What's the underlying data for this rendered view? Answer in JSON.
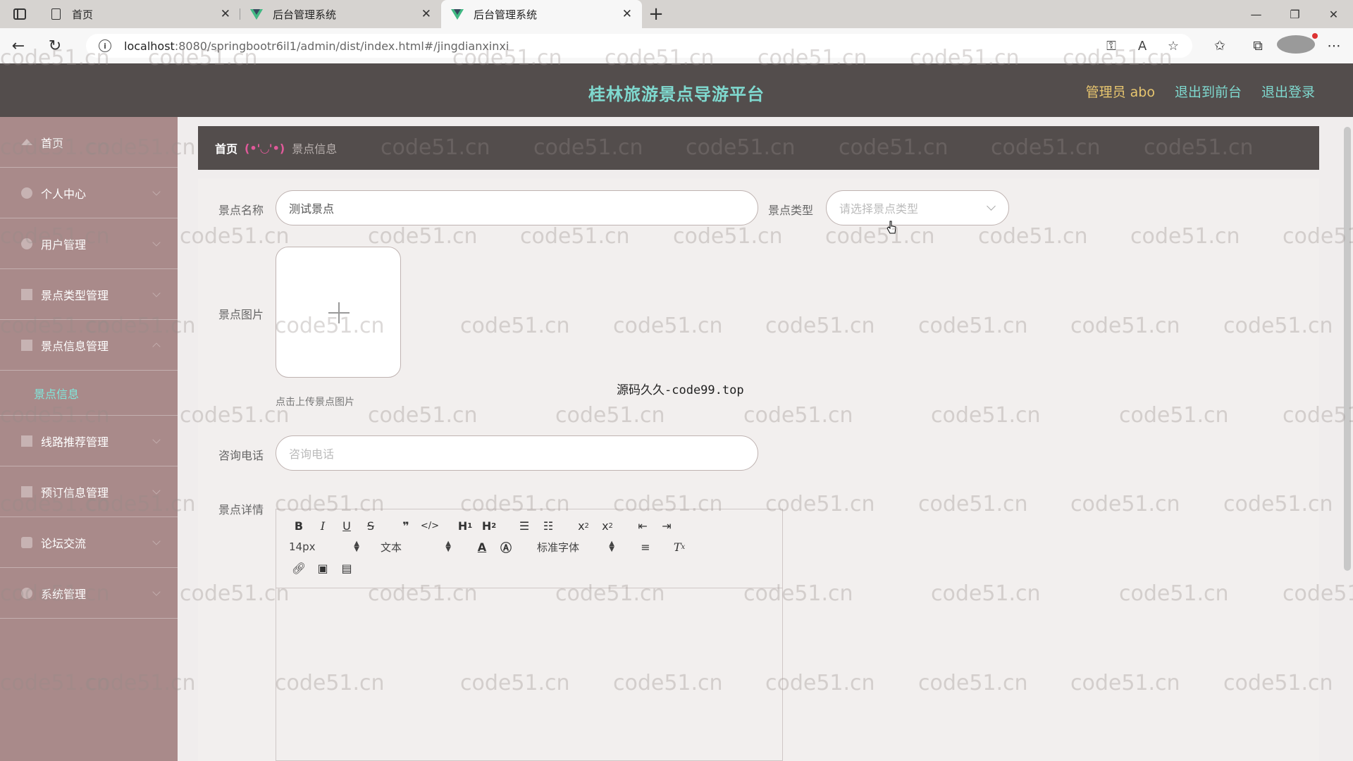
{
  "browser": {
    "tabs": [
      {
        "title": "首页",
        "icon": "doc-icon"
      },
      {
        "title": "后台管理系统",
        "icon": "vue-icon"
      },
      {
        "title": "后台管理系统",
        "icon": "vue-icon",
        "active": true
      }
    ],
    "url_host": "localhost",
    "url_path": ":8080/springbootr6il1/admin/dist/index.html#/jingdianxinxi"
  },
  "header": {
    "title": "桂林旅游景点导游平台",
    "user": "管理员 abo",
    "back_front": "退出到前台",
    "logout": "退出登录"
  },
  "sidebar": {
    "items": [
      {
        "label": "首页"
      },
      {
        "label": "个人中心"
      },
      {
        "label": "用户管理"
      },
      {
        "label": "景点类型管理"
      },
      {
        "label": "景点信息管理"
      },
      {
        "label": "景点信息",
        "sub": true
      },
      {
        "label": "线路推荐管理"
      },
      {
        "label": "预订信息管理"
      },
      {
        "label": "论坛交流"
      },
      {
        "label": "系统管理"
      }
    ]
  },
  "breadcrumb": {
    "home": "首页",
    "separator": "(•'◡'•)",
    "current": "景点信息"
  },
  "form": {
    "name_label": "景点名称",
    "name_value": "测试景点",
    "type_label": "景点类型",
    "type_placeholder": "请选择景点类型",
    "image_label": "景点图片",
    "image_tip": "点击上传景点图片",
    "phone_label": "咨询电话",
    "phone_placeholder": "咨询电话",
    "detail_label": "景点详情"
  },
  "overlay_text": "源码久久-code99.top",
  "watermark": "code51.cn",
  "editor": {
    "font_size": "14px",
    "block_type": "文本",
    "font_family": "标准字体"
  }
}
